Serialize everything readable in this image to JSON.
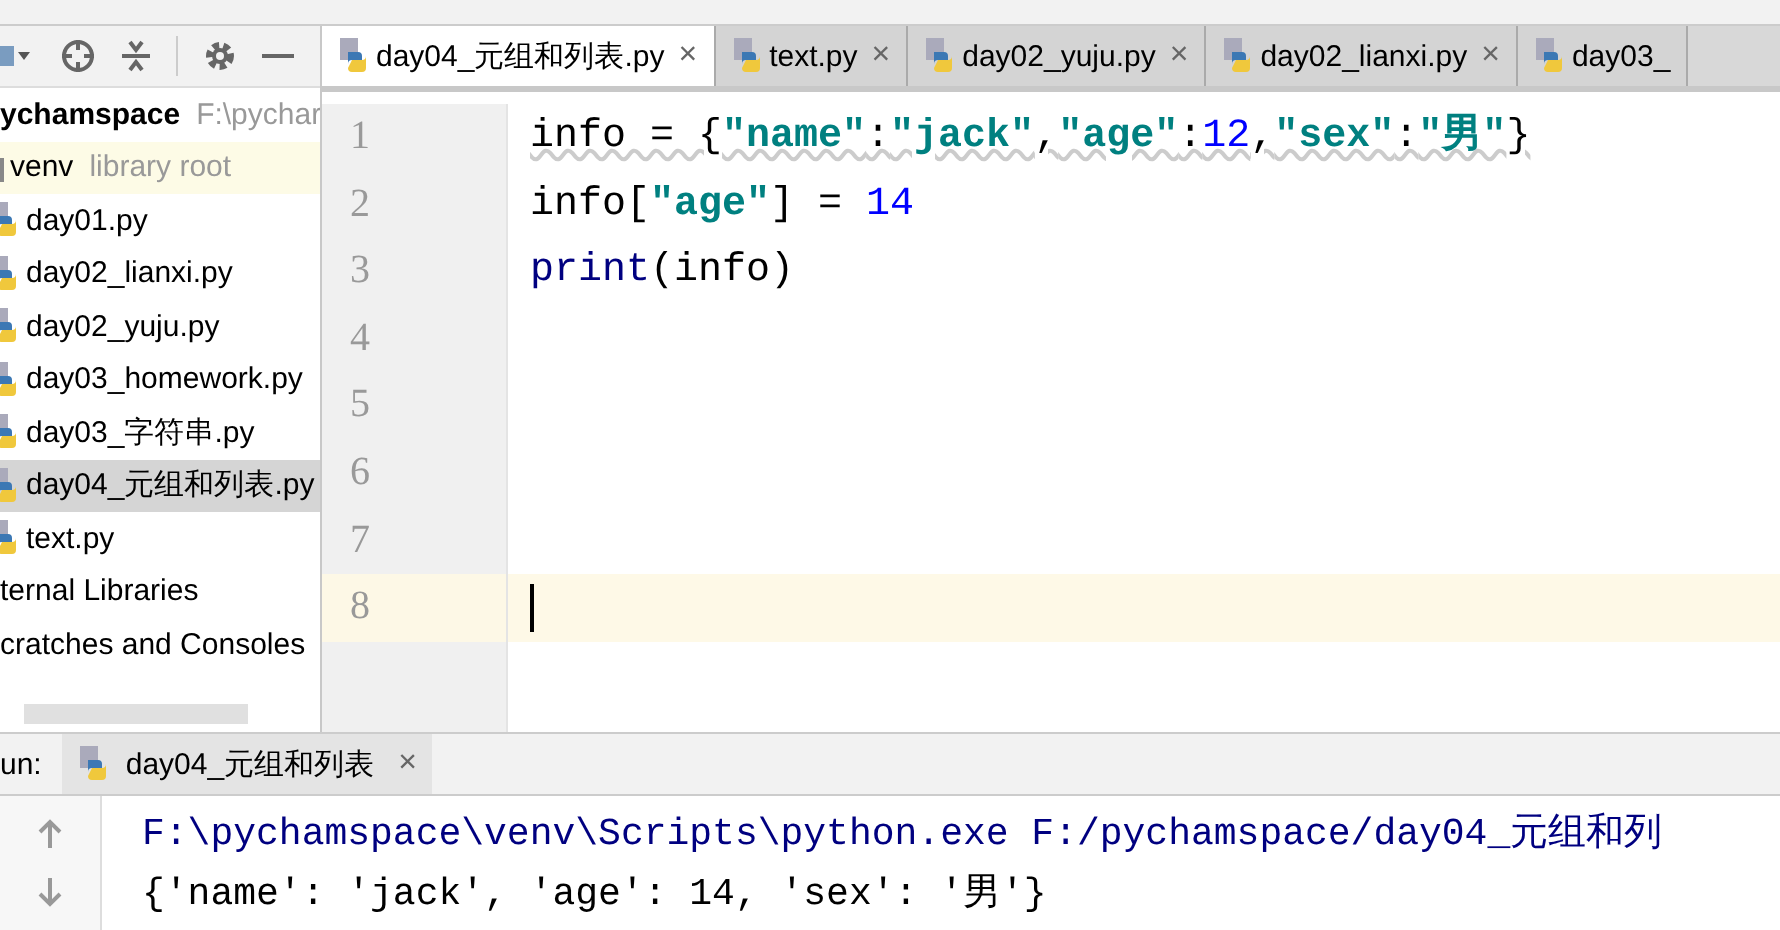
{
  "project_tree": {
    "root": {
      "label": "ychamspace",
      "hint": "F:\\pychar",
      "children": [
        {
          "kind": "folder",
          "label": "venv",
          "hint": "library root",
          "selected": false
        },
        {
          "kind": "file",
          "label": "day01.py",
          "selected": false
        },
        {
          "kind": "file",
          "label": "day02_lianxi.py",
          "selected": false
        },
        {
          "kind": "file",
          "label": "day02_yuju.py",
          "selected": false
        },
        {
          "kind": "file",
          "label": "day03_homework.py",
          "selected": false
        },
        {
          "kind": "file",
          "label": "day03_字符串.py",
          "selected": false
        },
        {
          "kind": "file",
          "label": "day04_元组和列表.py",
          "selected": true
        },
        {
          "kind": "file",
          "label": "text.py",
          "selected": false
        }
      ]
    },
    "others": [
      {
        "kind": "group",
        "label": "ternal Libraries"
      },
      {
        "kind": "group",
        "label": "cratches and Consoles"
      }
    ]
  },
  "tabs": [
    {
      "label": "day04_元组和列表.py",
      "selected": true,
      "close": "×"
    },
    {
      "label": "text.py",
      "selected": false,
      "close": "×"
    },
    {
      "label": "day02_yuju.py",
      "selected": false,
      "close": "×"
    },
    {
      "label": "day02_lianxi.py",
      "selected": false,
      "close": "×"
    },
    {
      "label": "day03_",
      "selected": false
    }
  ],
  "editor": {
    "lines": [
      {
        "number": "1",
        "tokens": [
          {
            "kind": "plain",
            "text": "info = {"
          },
          {
            "kind": "string",
            "text": "\"name\""
          },
          {
            "kind": "plain",
            "text": ":"
          },
          {
            "kind": "string",
            "text": "\"jack\""
          },
          {
            "kind": "plain",
            "text": ","
          },
          {
            "kind": "string",
            "text": "\"age\""
          },
          {
            "kind": "plain",
            "text": ":"
          },
          {
            "kind": "number",
            "text": "12"
          },
          {
            "kind": "plain",
            "text": ","
          },
          {
            "kind": "string",
            "text": "\"sex\""
          },
          {
            "kind": "plain",
            "text": ":"
          },
          {
            "kind": "string",
            "text": "\"男\""
          },
          {
            "kind": "plain",
            "text": "}"
          }
        ]
      },
      {
        "number": "2",
        "tokens": [
          {
            "kind": "plain",
            "text": "info["
          },
          {
            "kind": "string",
            "text": "\"age\""
          },
          {
            "kind": "plain",
            "text": "] = "
          },
          {
            "kind": "number",
            "text": "14"
          }
        ]
      },
      {
        "number": "3",
        "tokens": [
          {
            "kind": "builtin",
            "text": "print"
          },
          {
            "kind": "plain",
            "text": "(info)"
          }
        ]
      },
      {
        "number": "4",
        "current": false
      },
      {
        "number": "5",
        "current": false
      },
      {
        "number": "6",
        "current": false
      },
      {
        "number": "7",
        "current": false
      },
      {
        "number": "8",
        "current": true
      }
    ]
  },
  "run_panel": {
    "label": "un:",
    "tab": {
      "label": "day04_元组和列表",
      "close": "×",
      "selected": true
    },
    "output": [
      "F:\\pychamspace\\venv\\Scripts\\python.exe F:/pychamspace/day04_元组和列",
      "{'name': 'jack', 'age': 14, 'sex': '男'}"
    ]
  }
}
